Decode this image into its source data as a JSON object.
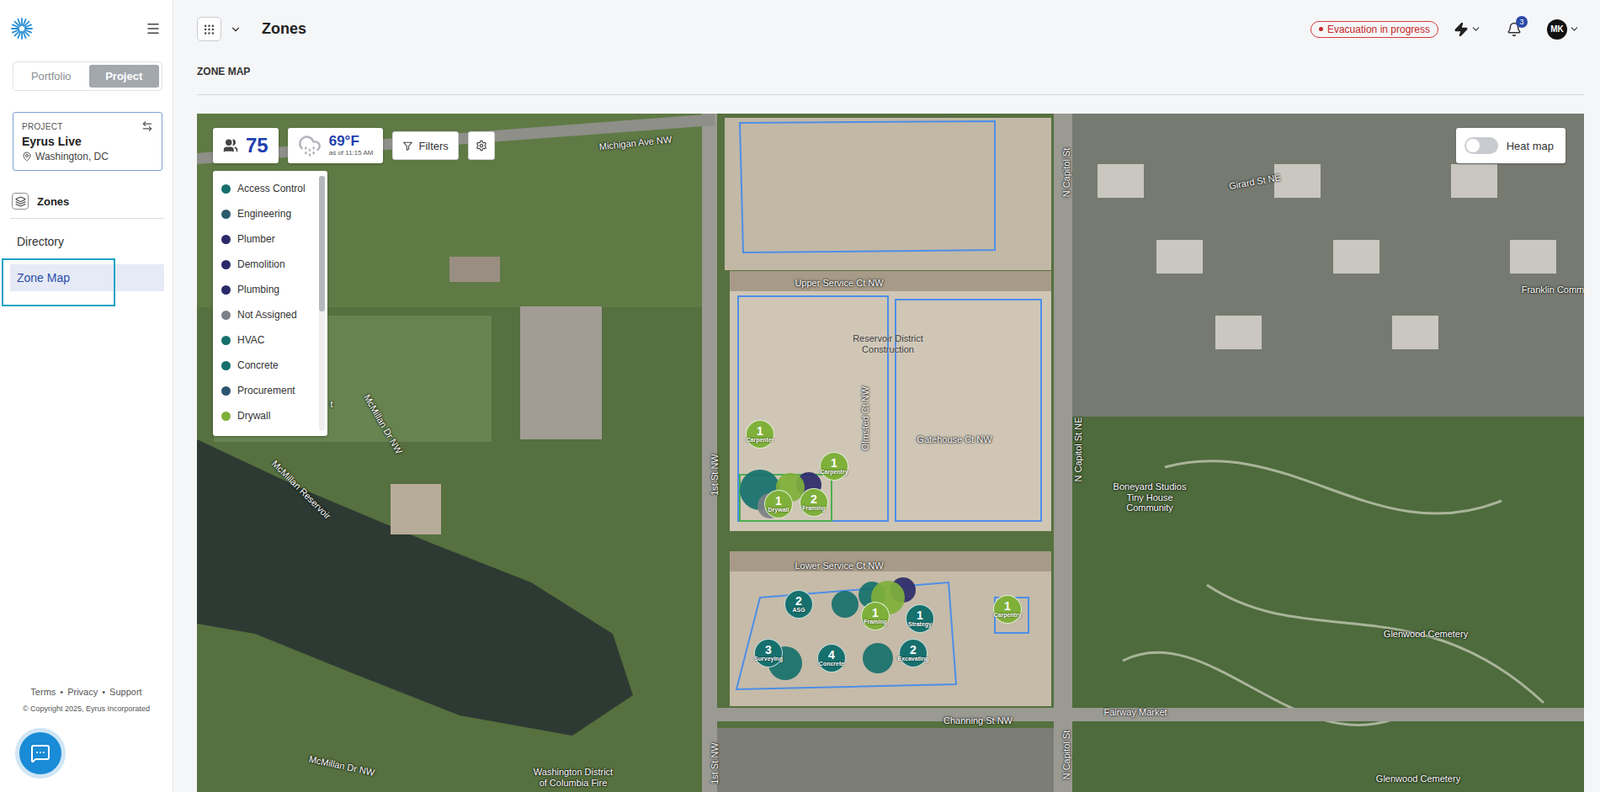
{
  "sidebar": {
    "toggle": [
      {
        "label": "Portfolio",
        "selected": false
      },
      {
        "label": "Project",
        "selected": true
      }
    ],
    "project": {
      "caption": "PROJECT",
      "name": "Eyrus Live",
      "location": "Washington, DC"
    },
    "section": "Zones",
    "items": [
      {
        "label": "Directory",
        "selected": false
      },
      {
        "label": "Zone Map",
        "selected": true
      }
    ],
    "footer_links": [
      "Terms",
      "Privacy",
      "Support"
    ],
    "separator": "•",
    "copyright": "© Copyright 2025, Eyrus Incorporated"
  },
  "header": {
    "title": "Zones",
    "alert": "Evacuation in progress",
    "notifications": "3",
    "avatar": "MK"
  },
  "page": {
    "heading": "ZONE MAP"
  },
  "map": {
    "headcount": "75",
    "weather": {
      "temp": "69°F",
      "time": "as of 11:15 AM"
    },
    "filters": "Filters",
    "heatmap": {
      "label": "Heat map",
      "on": false
    },
    "legend": {
      "items": [
        {
          "label": "Access Control",
          "color": "#16706d"
        },
        {
          "label": "Engineering",
          "color": "#2c5a6e"
        },
        {
          "label": "Plumber",
          "color": "#2b2a6a"
        },
        {
          "label": "Demolition",
          "color": "#2b2a6a"
        },
        {
          "label": "Plumbing",
          "color": "#2b2a6a"
        },
        {
          "label": "Not Assigned",
          "color": "#7c8088"
        },
        {
          "label": "HVAC",
          "color": "#16706d"
        },
        {
          "label": "Concrete",
          "color": "#16706d"
        },
        {
          "label": "Procurement",
          "color": "#2e5570"
        },
        {
          "label": "Drywall",
          "color": "#7fb03a"
        }
      ],
      "scroll": {
        "level": 0.53
      }
    },
    "labels": [
      "Michigan Ave NW",
      "Upper Service Ct NW",
      "Reservoir District Construction",
      "Olmsted Ct NW",
      "Gatehouse Ct NW",
      "Lower Service Ct NW",
      "Channing St NW",
      "1st St NW",
      "1st St NW",
      "N Capitol St",
      "N Capitol St NE",
      "N Capitol St",
      "Girard St NE",
      "Franklin Comm",
      "McMillan Reservoir",
      "McMillan Dr NW",
      "McMillan Dr NW",
      "Glenwood Cemetery",
      "Boneyard Studios Tiny House Community",
      "Fairway Market",
      "Washington District of Columbia Fire",
      "Glenwood Cemetery",
      "t"
    ],
    "markers": [
      {
        "count": "1",
        "label": "Carpenter",
        "color": "#7fb03a"
      },
      {
        "count": "1",
        "label": "Carpentry",
        "color": "#7fb03a"
      },
      {
        "count": "1",
        "label": "Drywall",
        "color": "#7fb03a"
      },
      {
        "count": "2",
        "label": "Framing",
        "color": "#7fb03a"
      },
      {
        "count": "2",
        "label": "ASG",
        "color": "#16706d"
      },
      {
        "count": "1",
        "label": "Framing",
        "color": "#7fb03a"
      },
      {
        "count": "1",
        "label": "Strategy",
        "color": "#16706d"
      },
      {
        "count": "1",
        "label": "Carpentry",
        "color": "#7fb03a"
      },
      {
        "count": "3",
        "label": "Surveying",
        "color": "#16706d"
      },
      {
        "count": "4",
        "label": "Concrete",
        "color": "#16706d"
      },
      {
        "count": "2",
        "label": "Excavating",
        "color": "#16706d"
      }
    ],
    "bubbles": [
      {
        "color": "#16706d"
      },
      {
        "color": "#2b2a6a"
      },
      {
        "color": "#7c8088"
      },
      {
        "color": "#7fb03a"
      },
      {
        "color": "#16706d"
      },
      {
        "color": "#16706d"
      },
      {
        "color": "#2b2a6a"
      },
      {
        "color": "#7fb03a"
      },
      {
        "color": "#16706d"
      },
      {
        "color": "#16706d"
      }
    ]
  }
}
